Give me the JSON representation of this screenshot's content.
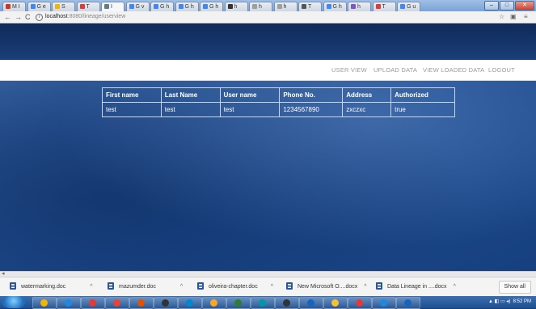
{
  "browser": {
    "tabs": [
      {
        "label": "M I",
        "color": "#d93025"
      },
      {
        "label": "G e",
        "color": "#4285f4"
      },
      {
        "label": "S",
        "color": "#f4b400"
      },
      {
        "label": "T",
        "color": "#e53935"
      },
      {
        "label": "I",
        "color": "#607d8b"
      },
      {
        "label": "G v",
        "color": "#4285f4"
      },
      {
        "label": "G h",
        "color": "#4285f4"
      },
      {
        "label": "G h",
        "color": "#4285f4"
      },
      {
        "label": "G h",
        "color": "#4285f4"
      },
      {
        "label": "h",
        "color": "#333333"
      },
      {
        "label": "h",
        "color": "#9e9e9e"
      },
      {
        "label": "h",
        "color": "#9e9e9e"
      },
      {
        "label": "T",
        "color": "#555555"
      },
      {
        "label": "G h",
        "color": "#4285f4"
      },
      {
        "label": "h",
        "color": "#7e57c2"
      },
      {
        "label": "T",
        "color": "#e53935"
      },
      {
        "label": "G u",
        "color": "#4285f4"
      }
    ],
    "window_buttons": {
      "minimize": "–",
      "maximize": "□",
      "close": "✕"
    },
    "nav": {
      "back": "←",
      "forward": "→",
      "reload": "C"
    },
    "url_host": "localhost",
    "url_rest": ":8080/lineage/userview",
    "star_icon": "☆"
  },
  "navbar": {
    "items": [
      "USER VIEW",
      "UPLOAD DATA",
      "VIEW LOADED DATA",
      "LOGOUT"
    ]
  },
  "users_table": {
    "headers": [
      "First name",
      "Last Name",
      "User name",
      "Phone No.",
      "Address",
      "Authorized"
    ],
    "rows": [
      [
        "test",
        "test",
        "test",
        "1234567890",
        "zxczxc",
        "true"
      ]
    ]
  },
  "downloads": {
    "items": [
      "watermarking.doc",
      "mazumder.doc",
      "oliveira-chapter.doc",
      "New Microsoft O....docx",
      "Data Lineage in ....docx"
    ],
    "show_all": "Show all"
  },
  "taskbar": {
    "apps": [
      "#f4b400",
      "#1e88e5",
      "#e53935",
      "#ea4335",
      "#e65100",
      "#333333",
      "#0288d1",
      "#f9a825",
      "#2e7d32",
      "#0097a7",
      "#333333",
      "#1565c0",
      "#fbc02d",
      "#e53935",
      "#1e88e5",
      "#1565c0"
    ],
    "time": "8:52 PM"
  },
  "colors": {
    "navbar_text": "#9a9a9a",
    "table_border": "#c9d6ea",
    "page_bg": "#1d4a8d"
  }
}
